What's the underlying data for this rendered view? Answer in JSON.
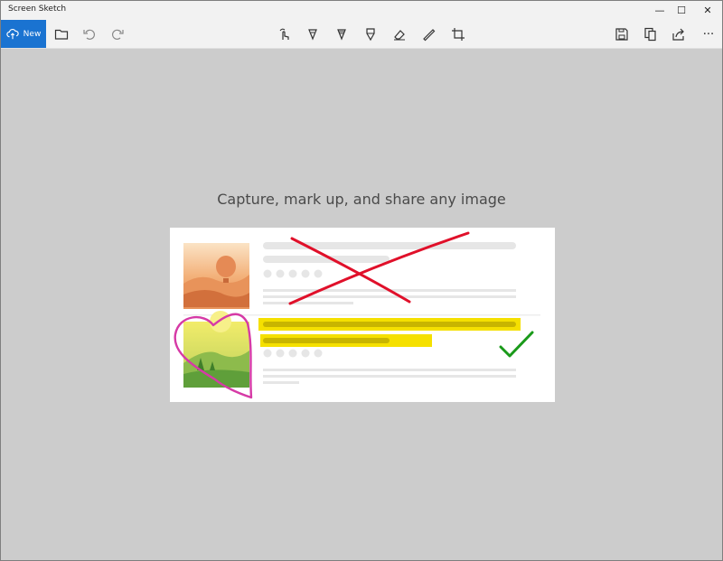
{
  "window": {
    "title": "Screen Sketch",
    "controls": {
      "minimize": "—",
      "maximize": "☐",
      "close": "✕"
    }
  },
  "toolbar": {
    "new_label": "New",
    "left_tools": [
      "folder-icon",
      "undo-icon",
      "redo-icon"
    ],
    "center_tools": [
      "touch-writing-icon",
      "ballpoint-pen-icon",
      "pencil-icon",
      "highlighter-icon",
      "eraser-icon",
      "ruler-icon",
      "crop-icon"
    ],
    "right_tools": [
      "save-icon",
      "copy-icon",
      "share-icon",
      "more-icon"
    ],
    "more_label": "···"
  },
  "main": {
    "tagline": "Capture, mark up, and share any image"
  },
  "colors": {
    "accent": "#1a73d1",
    "background": "#cccccc",
    "ink_red": "#e0102a",
    "ink_pink": "#d63aa6",
    "ink_green": "#1a9a1a",
    "highlight_yellow": "#f5e000"
  }
}
